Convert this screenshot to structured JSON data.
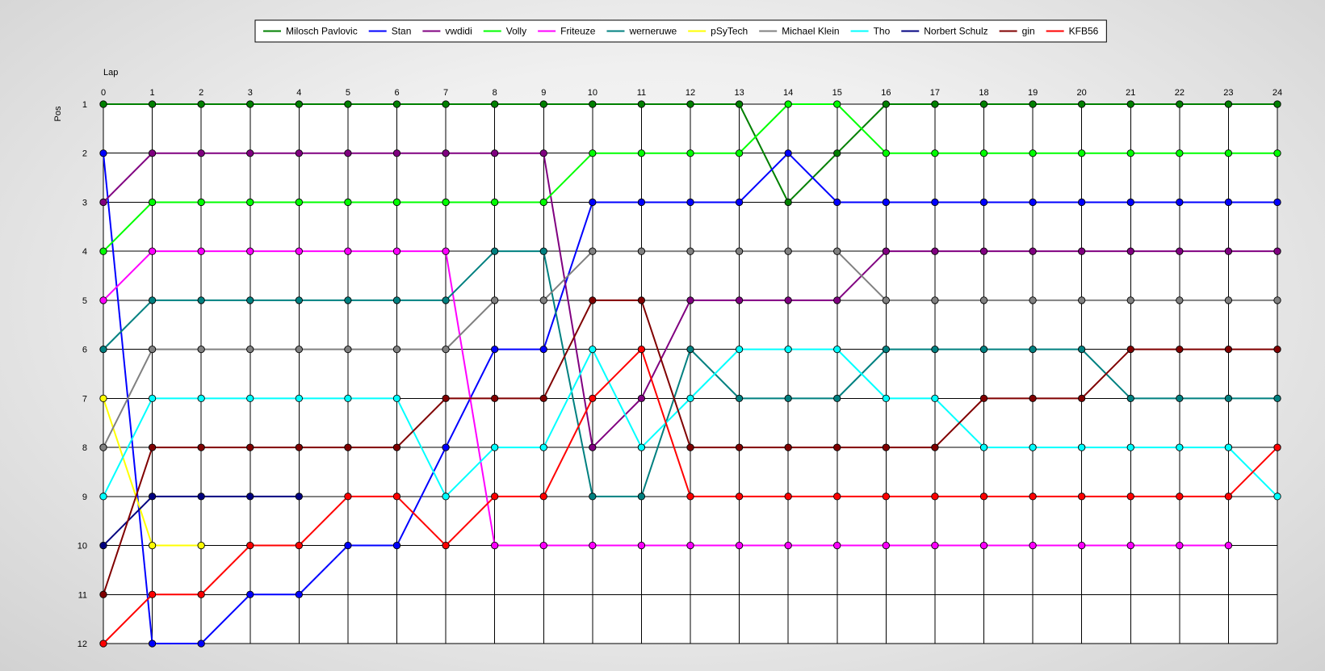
{
  "chart_data": {
    "type": "line",
    "xlabel": "Lap",
    "ylabel": "Pos",
    "x": [
      0,
      1,
      2,
      3,
      4,
      5,
      6,
      7,
      8,
      9,
      10,
      11,
      12,
      13,
      14,
      15,
      16,
      17,
      18,
      19,
      20,
      21,
      22,
      23,
      24
    ],
    "xlim": [
      0,
      24
    ],
    "ylim": [
      1,
      12
    ],
    "y_inverted": true,
    "grid": true,
    "legend": "top-center",
    "series": [
      {
        "name": "Milosch Pavlovic",
        "color": "#008000",
        "values": [
          1,
          1,
          1,
          1,
          1,
          1,
          1,
          1,
          1,
          1,
          1,
          1,
          1,
          1,
          3,
          2,
          1,
          1,
          1,
          1,
          1,
          1,
          1,
          1,
          1
        ]
      },
      {
        "name": "Stan",
        "color": "#0000ff",
        "values": [
          2,
          12,
          12,
          11,
          11,
          10,
          10,
          8,
          6,
          6,
          3,
          3,
          3,
          3,
          2,
          3,
          3,
          3,
          3,
          3,
          3,
          3,
          3,
          3,
          3
        ]
      },
      {
        "name": "vwdidi",
        "color": "#800080",
        "values": [
          3,
          2,
          2,
          2,
          2,
          2,
          2,
          2,
          2,
          2,
          8,
          7,
          5,
          5,
          5,
          5,
          4,
          4,
          4,
          4,
          4,
          4,
          4,
          4,
          4
        ]
      },
      {
        "name": "Volly",
        "color": "#00ff00",
        "values": [
          4,
          3,
          3,
          3,
          3,
          3,
          3,
          3,
          3,
          3,
          2,
          2,
          2,
          2,
          1,
          1,
          2,
          2,
          2,
          2,
          2,
          2,
          2,
          2,
          2
        ]
      },
      {
        "name": "Friteuze",
        "color": "#ff00ff",
        "values": [
          5,
          4,
          4,
          4,
          4,
          4,
          4,
          4,
          10,
          10,
          10,
          10,
          10,
          10,
          10,
          10,
          10,
          10,
          10,
          10,
          10,
          10,
          10,
          10,
          null
        ]
      },
      {
        "name": "werneruwe",
        "color": "#008080",
        "values": [
          6,
          5,
          5,
          5,
          5,
          5,
          5,
          5,
          4,
          4,
          9,
          9,
          6,
          7,
          7,
          7,
          6,
          6,
          6,
          6,
          6,
          7,
          7,
          7,
          7
        ]
      },
      {
        "name": "pSyTech",
        "color": "#ffff00",
        "values": [
          7,
          10,
          10,
          null,
          null,
          null,
          null,
          null,
          null,
          null,
          null,
          null,
          null,
          null,
          null,
          null,
          null,
          null,
          null,
          null,
          null,
          null,
          null,
          null,
          null
        ]
      },
      {
        "name": "Michael Klein",
        "color": "#808080",
        "values": [
          8,
          6,
          6,
          6,
          6,
          6,
          6,
          6,
          5,
          5,
          4,
          4,
          4,
          4,
          4,
          4,
          5,
          5,
          5,
          5,
          5,
          5,
          5,
          5,
          5
        ]
      },
      {
        "name": "Tho",
        "color": "#00ffff",
        "values": [
          9,
          7,
          7,
          7,
          7,
          7,
          7,
          9,
          8,
          8,
          6,
          8,
          7,
          6,
          6,
          6,
          7,
          7,
          8,
          8,
          8,
          8,
          8,
          8,
          9
        ]
      },
      {
        "name": "Norbert Schulz",
        "color": "#000080",
        "values": [
          10,
          9,
          9,
          9,
          9,
          null,
          null,
          null,
          null,
          null,
          null,
          null,
          null,
          null,
          null,
          null,
          null,
          null,
          null,
          null,
          null,
          null,
          null,
          null,
          null
        ]
      },
      {
        "name": "gin",
        "color": "#800000",
        "values": [
          11,
          8,
          8,
          8,
          8,
          8,
          8,
          7,
          7,
          7,
          5,
          5,
          8,
          8,
          8,
          8,
          8,
          8,
          7,
          7,
          7,
          6,
          6,
          6,
          6
        ]
      },
      {
        "name": "KFB56",
        "color": "#ff0000",
        "values": [
          12,
          11,
          11,
          10,
          10,
          9,
          9,
          10,
          9,
          9,
          7,
          6,
          9,
          9,
          9,
          9,
          9,
          9,
          9,
          9,
          9,
          9,
          9,
          9,
          8
        ]
      }
    ]
  }
}
